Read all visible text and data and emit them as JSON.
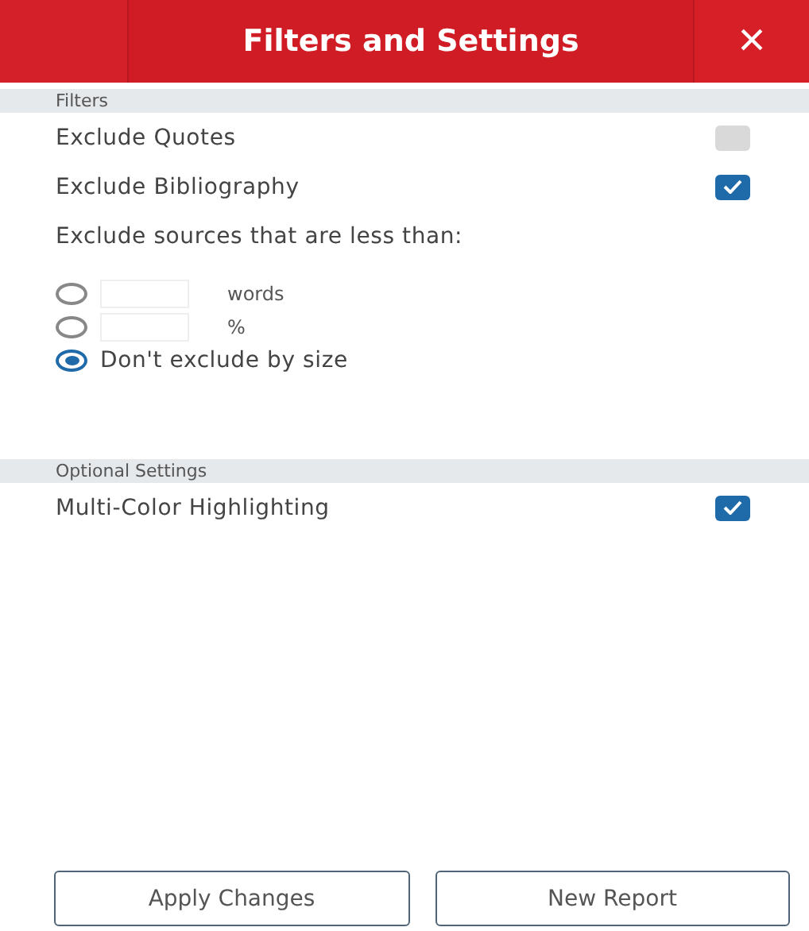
{
  "header": {
    "title": "Filters and Settings",
    "close": "×"
  },
  "filters": {
    "heading": "Filters",
    "options": [
      {
        "label": "Exclude Quotes",
        "checked": false
      },
      {
        "label": "Exclude Bibliography",
        "checked": true
      }
    ],
    "size_label": "Exclude sources that are less than:",
    "size_options": [
      {
        "kind": "input",
        "label": "words",
        "selected": false
      },
      {
        "kind": "input",
        "label": "%",
        "selected": false
      },
      {
        "kind": "plain",
        "label": "Don't exclude by size",
        "selected": true
      }
    ]
  },
  "optional": {
    "heading": "Optional Settings",
    "options": [
      {
        "label": "Multi-Color Highlighting",
        "checked": true
      }
    ]
  },
  "buttons": [
    "Apply Changes",
    "New Report"
  ]
}
